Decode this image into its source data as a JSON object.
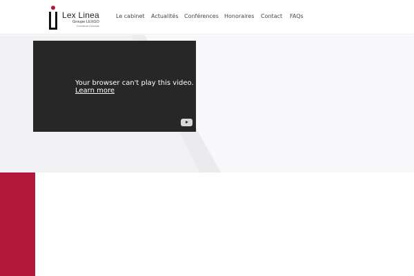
{
  "brand": {
    "name": "Lex Linea",
    "group": "Groupe LEXGO",
    "tagline": "Excellence d'avocats",
    "accent_color": "#b5163b"
  },
  "nav": {
    "items": [
      {
        "label": "Le cabinet"
      },
      {
        "label": "Actualités"
      },
      {
        "label": "Conférences"
      },
      {
        "label": "Honoraires"
      },
      {
        "label": "Contact"
      },
      {
        "label": "FAQs"
      }
    ]
  },
  "video": {
    "message": "Your browser can't play this video.",
    "link_label": "Learn more",
    "icon": "youtube-icon"
  }
}
